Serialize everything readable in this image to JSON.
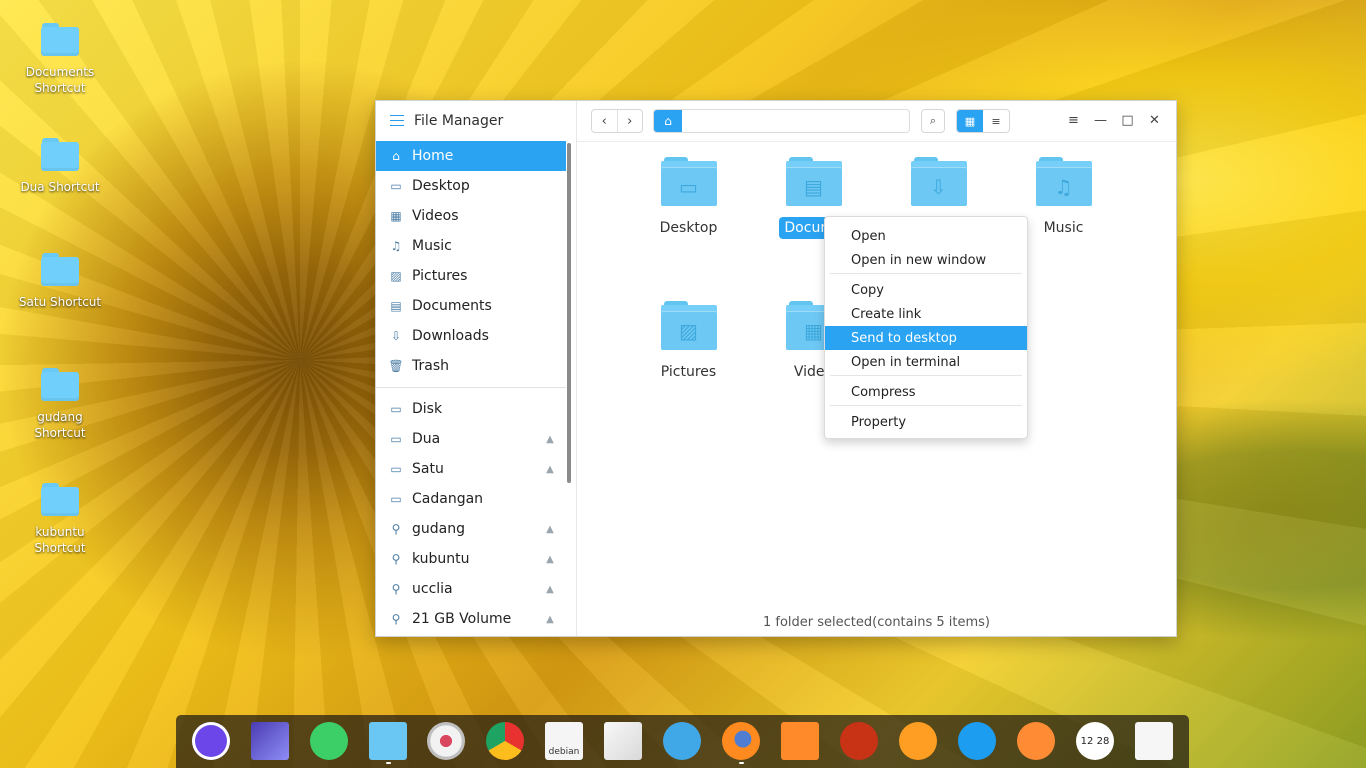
{
  "desktop_shortcuts": [
    {
      "label": "Documents Shortcut"
    },
    {
      "label": "Dua Shortcut"
    },
    {
      "label": "Satu Shortcut"
    },
    {
      "label": "gudang Shortcut"
    },
    {
      "label": "kubuntu Shortcut"
    }
  ],
  "window": {
    "title": "File Manager",
    "sidebar": [
      {
        "label": "Home",
        "icon": "home-icon"
      },
      {
        "label": "Desktop",
        "icon": "desktop-icon"
      },
      {
        "label": "Videos",
        "icon": "video-icon"
      },
      {
        "label": "Music",
        "icon": "music-icon"
      },
      {
        "label": "Pictures",
        "icon": "image-icon"
      },
      {
        "label": "Documents",
        "icon": "document-icon"
      },
      {
        "label": "Downloads",
        "icon": "download-icon"
      },
      {
        "label": "Trash",
        "icon": "trash-icon"
      },
      {
        "label": "Disk",
        "icon": "disk-icon"
      },
      {
        "label": "Dua",
        "icon": "disk-icon"
      },
      {
        "label": "Satu",
        "icon": "disk-icon"
      },
      {
        "label": "Cadangan",
        "icon": "disk-icon"
      },
      {
        "label": "gudang",
        "icon": "network-icon"
      },
      {
        "label": "kubuntu",
        "icon": "network-icon"
      },
      {
        "label": "ucclia",
        "icon": "network-icon"
      },
      {
        "label": "21 GB Volume",
        "icon": "network-icon"
      }
    ],
    "content_items": [
      {
        "label": "Desktop",
        "icon": "desktop-folder-icon"
      },
      {
        "label": "Documents",
        "icon": "documents-folder-icon"
      },
      {
        "label": "",
        "icon": "downloads-folder-icon"
      },
      {
        "label": "Music",
        "icon": "music-folder-icon"
      },
      {
        "label": "Pictures",
        "icon": "pictures-folder-icon"
      },
      {
        "label": "Videos",
        "icon": "videos-folder-icon"
      }
    ],
    "status": "1 folder selected(contains 5 items)"
  },
  "context_menu": {
    "items": [
      "Open",
      "Open in new window",
      "Copy",
      "Create link",
      "Send to desktop",
      "Open in terminal",
      "Compress",
      "Property"
    ],
    "highlighted": "Send to desktop"
  },
  "dock": {
    "apps": [
      {
        "icon": "launcher-icon",
        "color": "#6c46e8"
      },
      {
        "icon": "window-manager-icon",
        "color": "#6a54d8"
      },
      {
        "icon": "app-store-icon",
        "color": "#3ccf68"
      },
      {
        "icon": "file-manager-icon",
        "color": "#6ac7f3"
      },
      {
        "icon": "settings-icon",
        "color": "#e8e8e8"
      },
      {
        "icon": "chrome-icon",
        "color": "#ff2d2d"
      },
      {
        "icon": "debian-icon",
        "color": "#f5f5f5",
        "text": "debian"
      },
      {
        "icon": "image-viewer-icon",
        "color": "#f8f8f8"
      },
      {
        "icon": "telegram-icon",
        "color": "#41a8e8"
      },
      {
        "icon": "firefox-icon",
        "color": "#ff8a1f"
      },
      {
        "icon": "shopping-bag-icon",
        "color": "#ff8a2a"
      },
      {
        "icon": "power-icon",
        "color": "#c83215"
      },
      {
        "icon": "search-app-icon",
        "color": "#ff9e22"
      },
      {
        "icon": "wifi-icon",
        "color": "#1d9df0"
      },
      {
        "icon": "eject-icon",
        "color": "#ff8c34"
      },
      {
        "icon": "clock-icon",
        "color": "#ffffff",
        "text": "12 28"
      },
      {
        "icon": "trash-icon",
        "color": "#f6f6f6"
      }
    ]
  }
}
